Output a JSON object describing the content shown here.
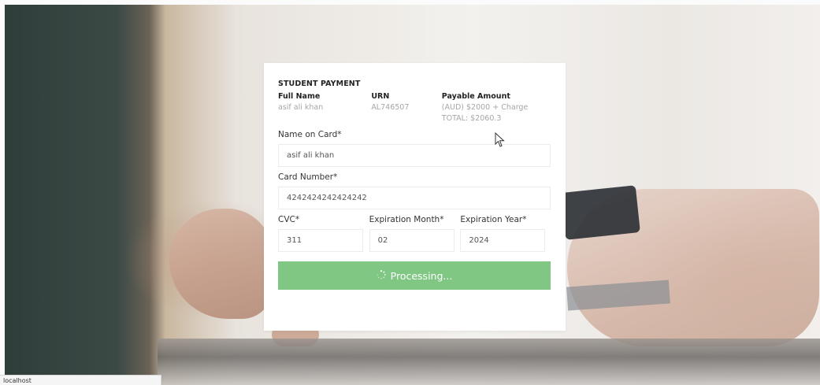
{
  "form": {
    "title": "STUDENT PAYMENT",
    "info": [
      {
        "label": "Full Name",
        "value": "asif ali khan",
        "value2": ""
      },
      {
        "label": "URN",
        "value": "AL746507",
        "value2": ""
      },
      {
        "label": "Payable Amount",
        "value": "(AUD) $2000 + Charge",
        "value2": "TOTAL: $2060.3"
      }
    ],
    "name_on_card": {
      "label": "Name on Card*",
      "value": "asif ali khan"
    },
    "card_number": {
      "label": "Card Number*",
      "value": "4242424242424242"
    },
    "cvc": {
      "label": "CVC*",
      "value": "311"
    },
    "exp_month": {
      "label": "Expiration Month*",
      "value": "02"
    },
    "exp_year": {
      "label": "Expiration Year*",
      "value": "2024"
    },
    "submit": {
      "label": "Processing...",
      "icon": "spinner-icon",
      "color": "#81c784"
    }
  },
  "status_bar": {
    "text": "localhost"
  }
}
